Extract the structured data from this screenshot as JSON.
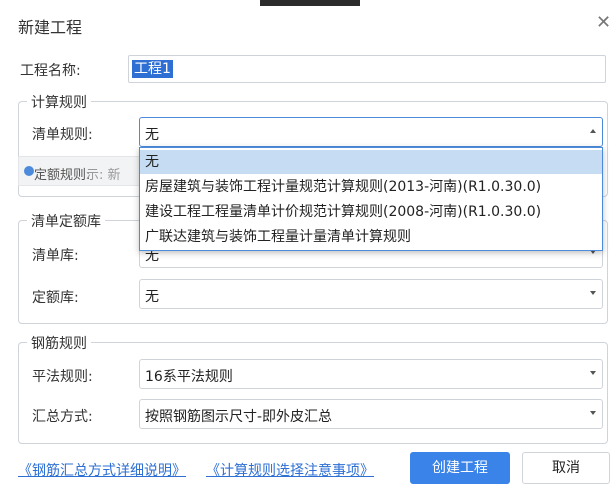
{
  "dialog": {
    "title": "新建工程",
    "close_icon": "close-icon"
  },
  "project": {
    "name_label": "工程名称:",
    "name_value": "工程1"
  },
  "calc_rules": {
    "title": "计算规则",
    "list_rule_label": "清单规则:",
    "list_rule_value": "无",
    "quota_rule_label": "定额规则:",
    "hint_text": "示: 新",
    "options": [
      "无",
      "房屋建筑与装饰工程计量规范计算规则(2013-河南)(R1.0.30.0)",
      "建设工程工程量清单计价规范计算规则(2008-河南)(R1.0.30.0)",
      "广联达建筑与装饰工程量计量清单计算规则"
    ]
  },
  "quota_lib": {
    "title": "清单定额库",
    "list_lib_label": "清单库:",
    "list_lib_value": "无",
    "quota_lib_label": "定额库:",
    "quota_lib_value": "无"
  },
  "rebar_rules": {
    "title": "钢筋规则",
    "flat_rule_label": "平法规则:",
    "flat_rule_value": "16系平法规则",
    "summary_label": "汇总方式:",
    "summary_value": "按照钢筋图示尺寸-即外皮汇总"
  },
  "footer": {
    "link_rebar": "《钢筋汇总方式详细说明》",
    "link_calc": "《计算规则选择注意事项》",
    "create_button": "创建工程",
    "cancel_button": "取消"
  }
}
